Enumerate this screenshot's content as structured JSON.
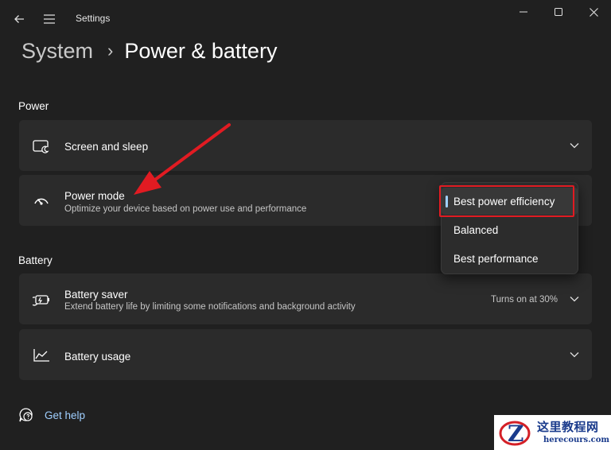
{
  "window": {
    "title": "Settings"
  },
  "breadcrumb": {
    "parent": "System",
    "separator": "›",
    "current": "Power & battery"
  },
  "sections": {
    "power": "Power",
    "battery": "Battery"
  },
  "cards": {
    "screen_sleep": {
      "title": "Screen and sleep",
      "icon": "screen-sleep-icon"
    },
    "power_mode": {
      "title": "Power mode",
      "description": "Optimize your device based on power use and performance",
      "icon": "power-mode-gauge-icon"
    },
    "battery_saver": {
      "title": "Battery saver",
      "description": "Extend battery life by limiting some notifications and background activity",
      "status": "Turns on at 30%",
      "icon": "battery-saver-icon"
    },
    "battery_usage": {
      "title": "Battery usage",
      "icon": "battery-usage-chart-icon"
    }
  },
  "power_mode_dropdown": {
    "selected": "Best power efficiency",
    "options": [
      "Best power efficiency",
      "Balanced",
      "Best performance"
    ]
  },
  "help": {
    "label": "Get help",
    "icon": "help-chat-icon"
  },
  "watermark": {
    "name_cn": "这里教程网",
    "domain": "herecours.com"
  },
  "colors": {
    "background": "#202020",
    "card": "#2b2b2b",
    "accent": "#9fcfff",
    "annotation_red": "#e11b22"
  }
}
